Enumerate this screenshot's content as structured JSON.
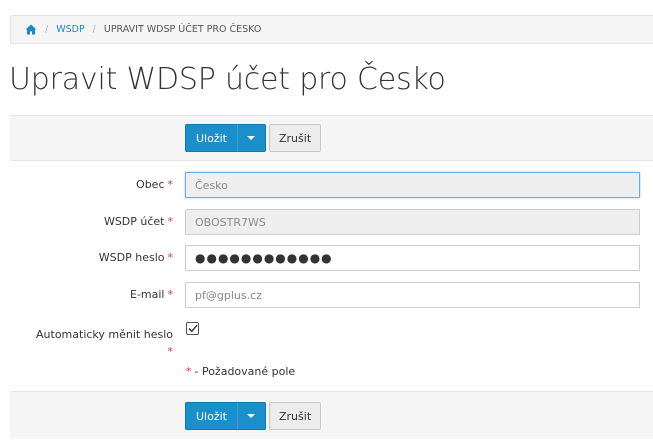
{
  "breadcrumb": {
    "home_icon": "home-icon",
    "separator": "/",
    "link": "WSDP",
    "current": "UPRAVIT WDSP ÚČET PRO ČESKO"
  },
  "title": "Upravit WDSP účet pro Česko",
  "toolbar": {
    "save_label": "Uložit",
    "cancel_label": "Zrušit"
  },
  "form": {
    "required_marker": "*",
    "fields": {
      "obec": {
        "label": "Obec",
        "value": "Česko"
      },
      "wsdp_account": {
        "label": "WSDP účet",
        "value": "OBOSTR7WS"
      },
      "wsdp_password": {
        "label": "WSDP heslo",
        "value": "●●●●●●●●●●●●"
      },
      "email": {
        "label": "E-mail",
        "value": "pf@gplus.cz"
      },
      "auto_password": {
        "label": "Automaticky měnit heslo",
        "checked": true
      }
    },
    "required_note": "- Požadované pole"
  },
  "colors": {
    "primary": "#1a8fc9",
    "required": "#d9363e",
    "link": "#1e88c7"
  }
}
